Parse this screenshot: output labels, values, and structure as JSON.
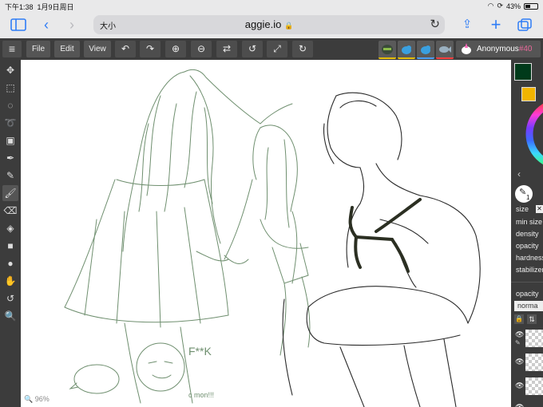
{
  "status": {
    "time": "下午1:38",
    "date": "1月9日周日",
    "battery": "43%",
    "battery_level": 0.43
  },
  "browser": {
    "reader_label": "大小",
    "host": "aggie.io"
  },
  "menu": {
    "file": "File",
    "edit": "Edit",
    "view": "View"
  },
  "user": {
    "name": "Anonymous",
    "number": "#40"
  },
  "canvas": {
    "zoom": "96%",
    "text_fk": "F**K",
    "text_mom": "c mon!!!"
  },
  "colors": {
    "primary": "#003a1a",
    "secondary": "#f0b400",
    "accent": "#2f7df6",
    "sketch": "#6f8f6f",
    "line": "#2a2a2a"
  },
  "brush": {
    "size_value": "1"
  },
  "props": {
    "size": "size",
    "min_size": "min size",
    "density": "density",
    "opacity": "opacity",
    "hardness": "hardness",
    "stabilizer": "stabilizer"
  },
  "layers": {
    "opacity": "opacity",
    "blend": "norma"
  }
}
